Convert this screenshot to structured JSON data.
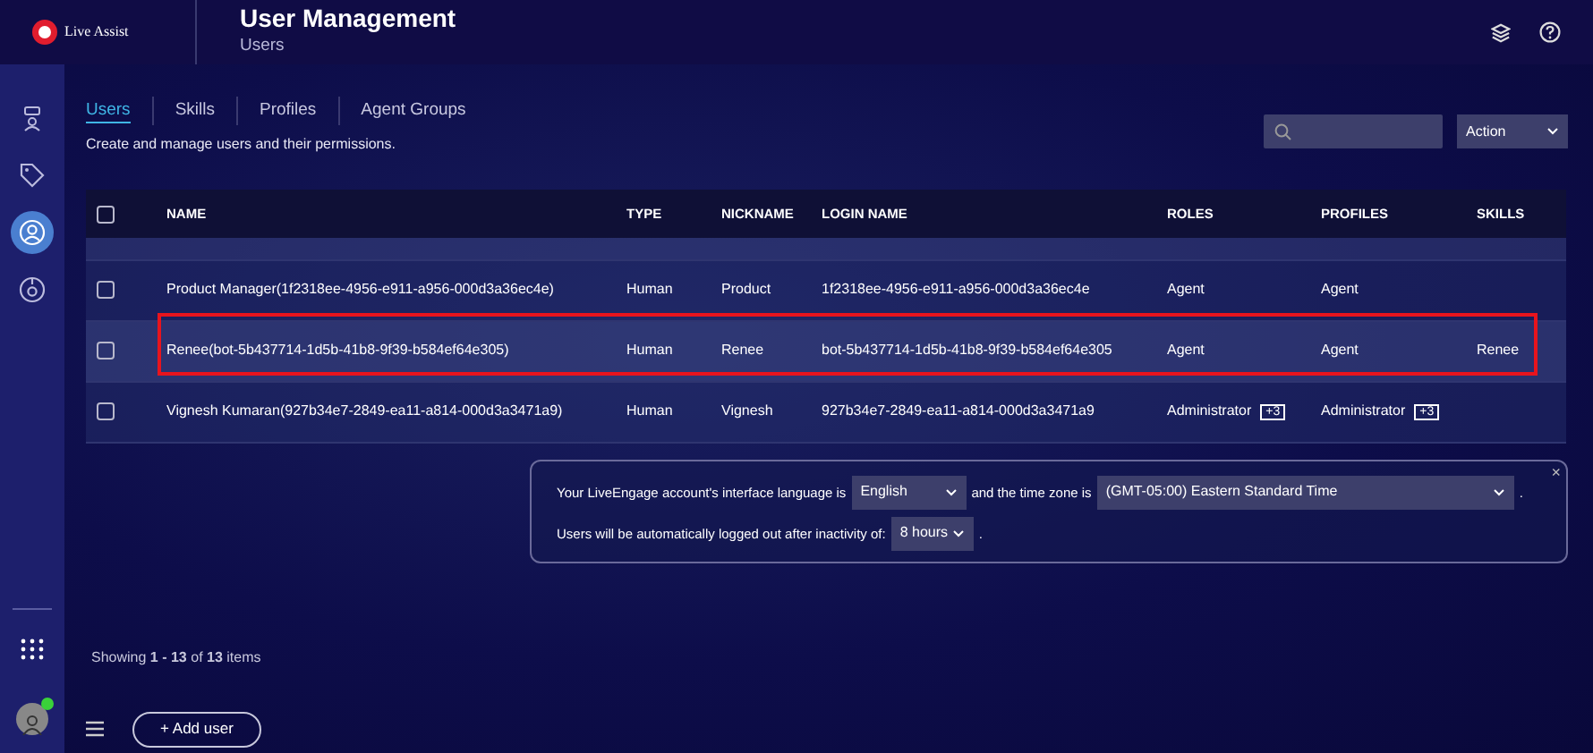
{
  "app": {
    "logo_text": "Live Assist"
  },
  "header": {
    "title": "User Management",
    "subtitle": "Users"
  },
  "sidebar": {
    "items": [
      {
        "kind": "robot",
        "selected": false
      },
      {
        "kind": "tag",
        "selected": false
      },
      {
        "kind": "user",
        "selected": true
      },
      {
        "kind": "gauge",
        "selected": false
      }
    ],
    "user_online": true
  },
  "tabs": [
    {
      "label": "Users",
      "selected": true
    },
    {
      "label": "Skills",
      "selected": false
    },
    {
      "label": "Profiles",
      "selected": false
    },
    {
      "label": "Agent Groups",
      "selected": false
    }
  ],
  "description": "Create and manage users and their permissions.",
  "action_select": {
    "value": "Action"
  },
  "table": {
    "columns": [
      "NAME",
      "TYPE",
      "NICKNAME",
      "LOGIN NAME",
      "ROLES",
      "PROFILES",
      "SKILLS"
    ],
    "select_all_checked": false,
    "rows": [
      {
        "checked": false,
        "highlighted": false,
        "name": "Product Manager(1f2318ee-4956-e911-a956-000d3a36ec4e)",
        "type": "Human",
        "nickname": "Product",
        "login": "1f2318ee-4956-e911-a956-000d3a36ec4e",
        "roles": {
          "text": "Agent"
        },
        "profiles": {
          "text": "Agent"
        }
      },
      {
        "checked": false,
        "highlighted": true,
        "name": "Renee(bot-5b437714-1d5b-41b8-9f39-b584ef64e305)",
        "type": "Human",
        "nickname": "Renee",
        "login": "bot-5b437714-1d5b-41b8-9f39-b584ef64e305",
        "roles": {
          "text": "Agent"
        },
        "profiles": {
          "text": "Agent"
        },
        "skills": "Renee"
      },
      {
        "checked": false,
        "highlighted": false,
        "name": "Vignesh Kumaran(927b34e7-2849-ea11-a814-000d3a3471a9)",
        "type": "Human",
        "nickname": "Vignesh",
        "login": "927b34e7-2849-ea11-a814-000d3a3471a9",
        "roles": {
          "text": "Administrator",
          "more": "+3"
        },
        "profiles": {
          "text": "Administrator",
          "more": "+3"
        }
      }
    ]
  },
  "notice": {
    "language_label": "Your LiveEngage account's interface language is",
    "language": "English",
    "timezone_label": "and the time zone is",
    "timezone": "(GMT-05:00) Eastern Standard Time",
    "period_1": ".",
    "logout_label": "Users will be automatically logged out after inactivity of:",
    "logout": "8 hours",
    "period_2": ".",
    "close": "×"
  },
  "footer": {
    "showing": "Showing **1 - 13** of **13** items",
    "add_button": "+ Add user"
  }
}
